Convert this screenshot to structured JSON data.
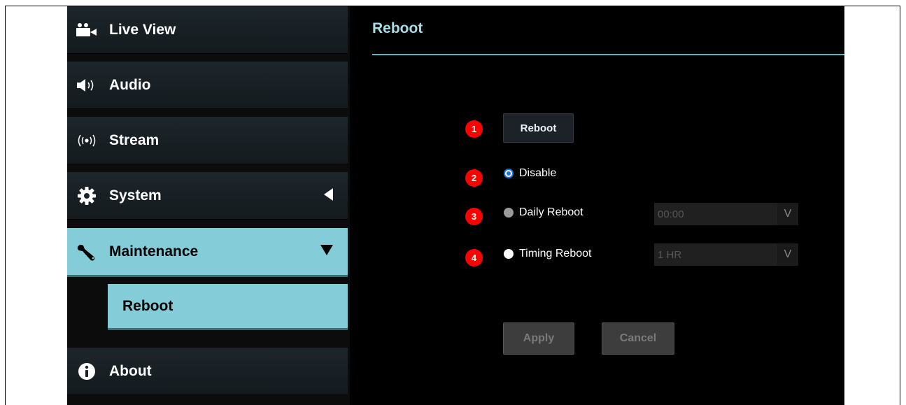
{
  "sidebar": {
    "items": [
      {
        "label": "Live View",
        "icon": "video-camera-icon"
      },
      {
        "label": "Audio",
        "icon": "speaker-icon"
      },
      {
        "label": "Stream",
        "icon": "broadcast-icon"
      },
      {
        "label": "System",
        "icon": "gear-icon"
      },
      {
        "label": "Maintenance",
        "icon": "wrench-icon"
      },
      {
        "label": "About",
        "icon": "info-icon"
      }
    ],
    "sub_items": [
      {
        "label": "Reboot"
      }
    ]
  },
  "main": {
    "title": "Reboot",
    "reboot_button": "Reboot",
    "badges": [
      "1",
      "2",
      "3",
      "4"
    ],
    "options": {
      "disable": "Disable",
      "daily": "Daily Reboot",
      "timing": "Timing Reboot"
    },
    "daily_select_value": "00:00",
    "timing_select_value": "1 HR",
    "select_chevron": "V",
    "apply_label": "Apply",
    "cancel_label": "Cancel"
  },
  "colors": {
    "accent": "#84cdd8",
    "title": "#a8dde8",
    "badge": "#ff0000",
    "radio_selected": "#1a73e8"
  }
}
